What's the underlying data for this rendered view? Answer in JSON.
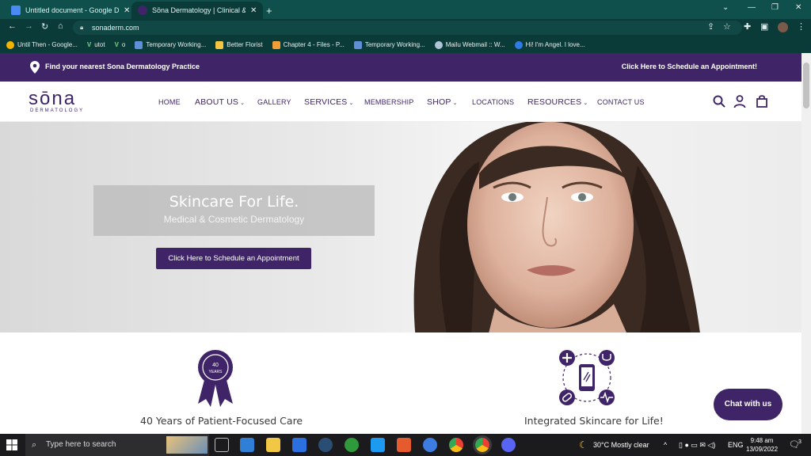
{
  "browser": {
    "tabs": [
      {
        "title": "Untitled document - Google Doc",
        "active": false
      },
      {
        "title": "Sōna Dermatology | Clinical & Co",
        "active": true
      }
    ],
    "new_tab": "+",
    "url": "sonaderm.com",
    "bookmarks": [
      "Until Then - Google...",
      "utot",
      "o",
      "Temporary Working...",
      "Better Florist",
      "Chapter 4 - Files - P...",
      "Temporary Working...",
      "Mailu Webmail :: W...",
      "Hi! I'm Angel. I love..."
    ]
  },
  "site": {
    "topbar": {
      "find": "Find your nearest Sona Dermatology Practice",
      "schedule": "Click Here to Schedule an Appointment!"
    },
    "logo": {
      "word": "sōna",
      "sub": "DERMATOLOGY"
    },
    "nav": {
      "home": "HOME",
      "about": "ABOUT US",
      "gallery": "GALLERY",
      "services": "SERVICES",
      "membership": "MEMBERSHIP",
      "shop": "SHOP",
      "locations": "LOCATIONS",
      "resources": "RESOURCES",
      "contact": "CONTACT US"
    },
    "hero": {
      "title": "Skincare For Life.",
      "subtitle": "Medical & Cosmetic Dermatology",
      "button": "Click Here to Schedule an Appointment"
    },
    "features": [
      {
        "caption": "40 Years of Patient-Focused Care",
        "badge_top": "40",
        "badge_bottom": "YEARS"
      },
      {
        "caption": "Integrated Skincare for Life!"
      }
    ],
    "chat": "Chat with us"
  },
  "taskbar": {
    "search_placeholder": "Type here to search",
    "weather": "30°C  Mostly clear",
    "language": "ENG",
    "time": "9:48 am",
    "date": "13/09/2022",
    "notification_count": "3"
  },
  "colors": {
    "brand_purple": "#3f2468",
    "chrome_dark": "#0b3b39"
  }
}
